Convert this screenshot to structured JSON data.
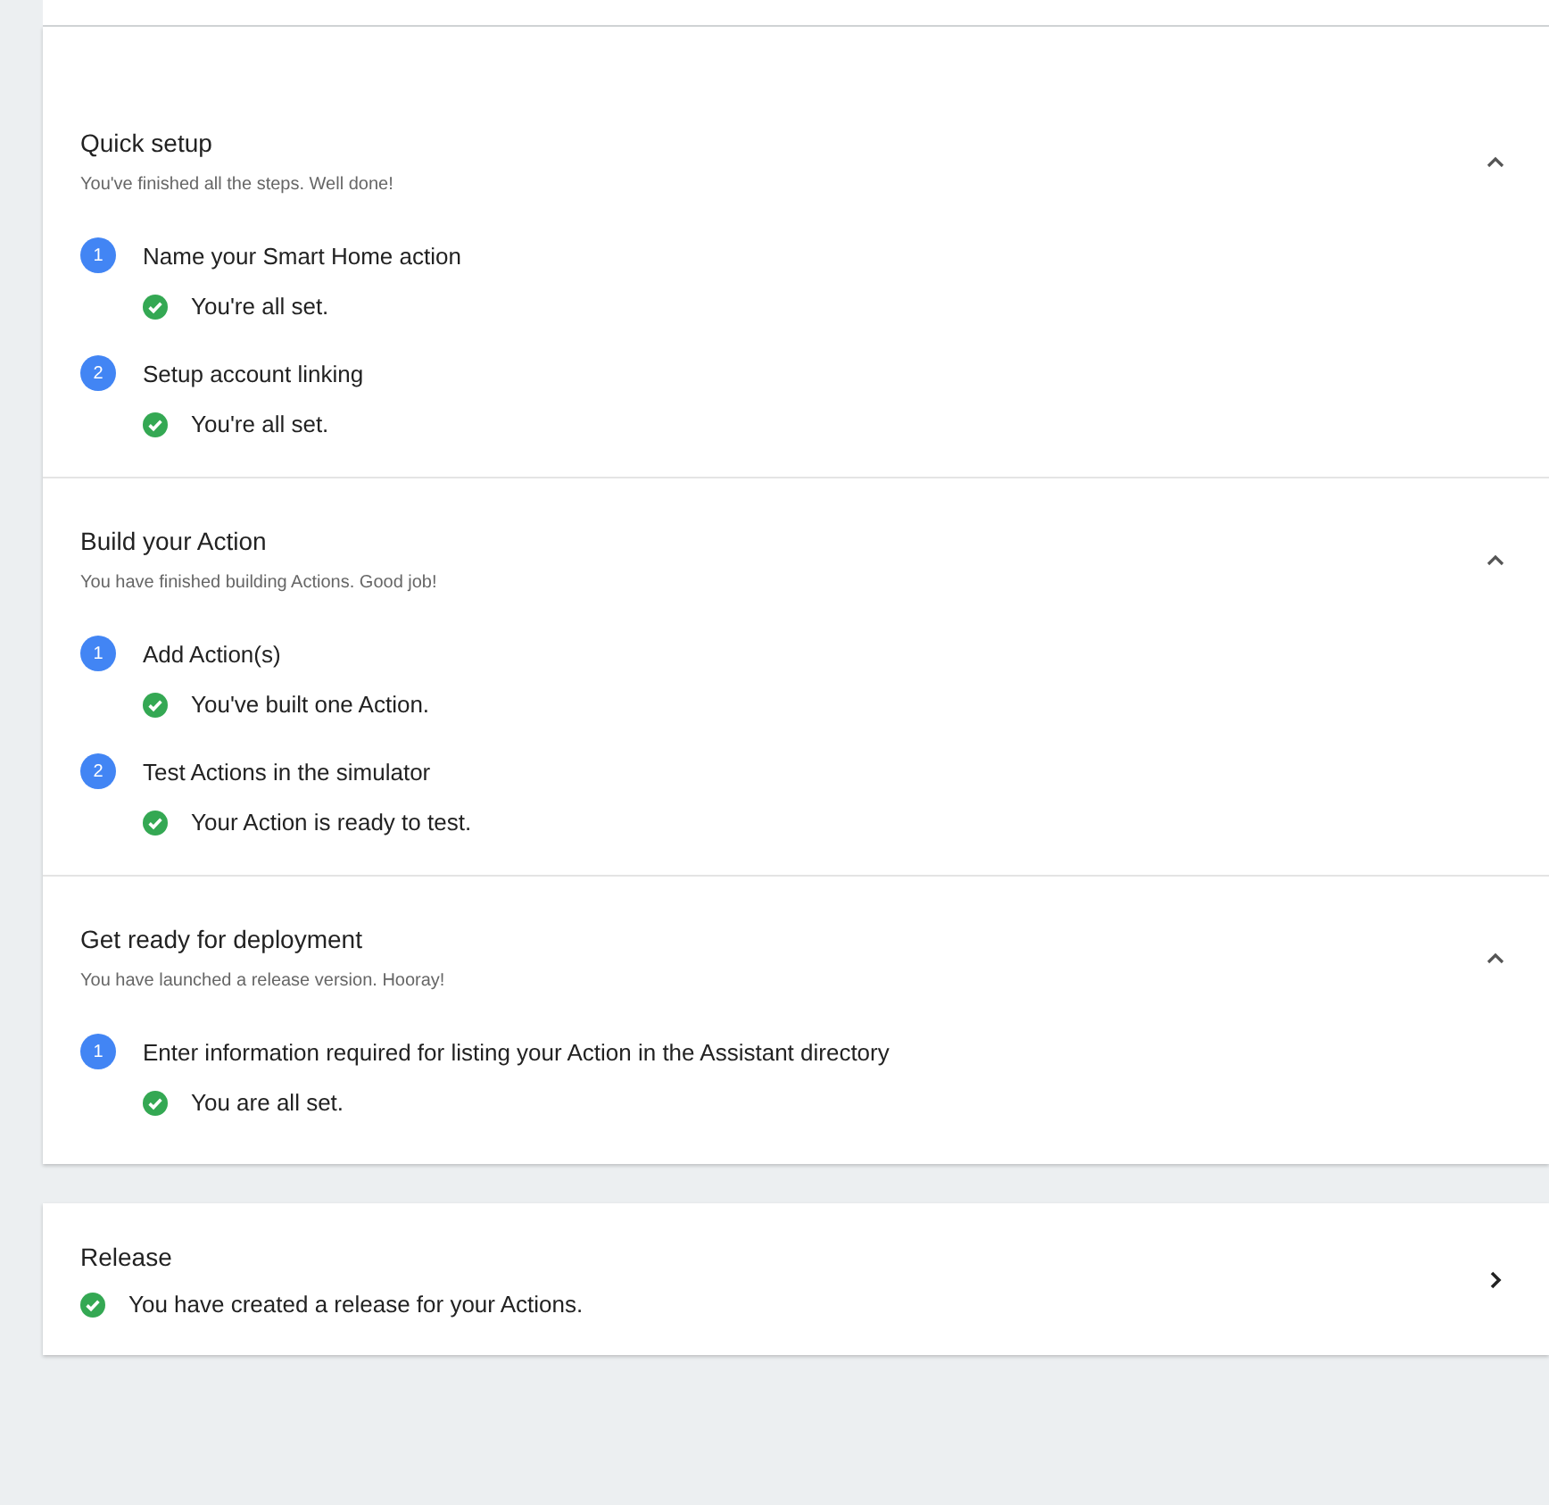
{
  "sections": [
    {
      "title": "Quick setup",
      "subtitle": "You've finished all the steps. Well done!",
      "expanded": true,
      "steps": [
        {
          "number": "1",
          "label": "Name your Smart Home action",
          "status": "You're all set."
        },
        {
          "number": "2",
          "label": "Setup account linking",
          "status": "You're all set."
        }
      ]
    },
    {
      "title": "Build your Action",
      "subtitle": "You have finished building Actions. Good job!",
      "expanded": true,
      "steps": [
        {
          "number": "1",
          "label": "Add Action(s)",
          "status": "You've built one Action."
        },
        {
          "number": "2",
          "label": "Test Actions in the simulator",
          "status": "Your Action is ready to test."
        }
      ]
    },
    {
      "title": "Get ready for deployment",
      "subtitle": "You have launched a release version. Hooray!",
      "expanded": true,
      "steps": [
        {
          "number": "1",
          "label": "Enter information required for listing your Action in the Assistant directory",
          "status": "You are all set."
        }
      ]
    }
  ],
  "release": {
    "title": "Release",
    "status": "You have created a release for your Actions.",
    "expanded": false
  }
}
